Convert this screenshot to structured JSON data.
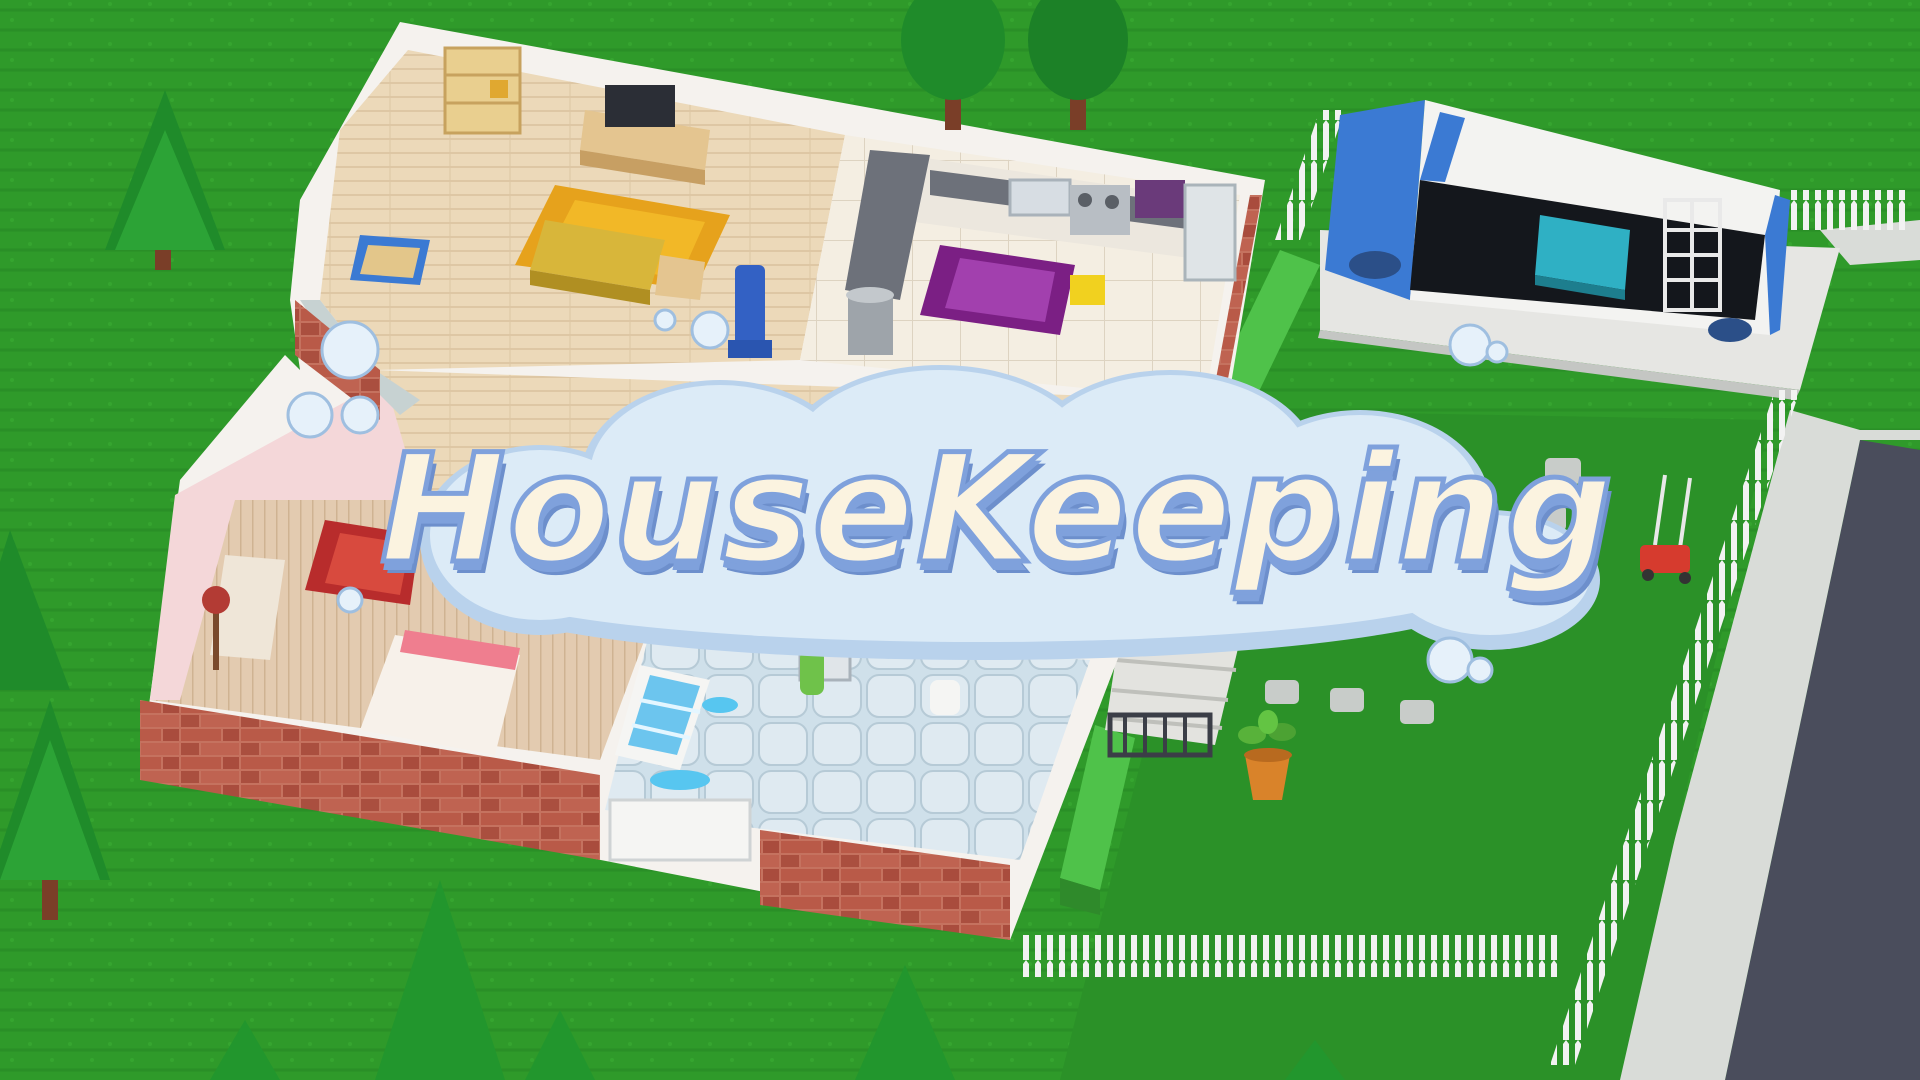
{
  "title": {
    "text": "HouseKeeping"
  },
  "colors": {
    "grass": "#2f9a2a",
    "grass_dark": "#268523",
    "wood_floor": "#ecd9b9",
    "kitchen_tile": "#f3ede0",
    "brick": "#b95a48",
    "wall_white": "#f5f2ee",
    "road": "#4a4d5c",
    "sidewalk": "#d9dcd8",
    "driveway": "#e6e6e3",
    "truck_blue": "#3b7ad3",
    "title_fill": "#fbf3e0",
    "title_outline": "#7fa1dc",
    "cloud": "#dcebf7"
  },
  "icons": [
    "tree-icon",
    "truck-icon",
    "lawnmower-icon",
    "plant-pot-icon",
    "bubble-icon"
  ]
}
